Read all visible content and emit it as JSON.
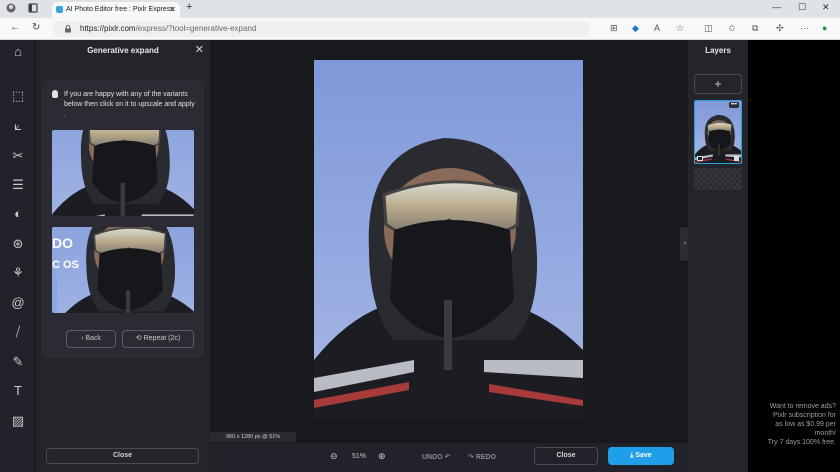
{
  "browser": {
    "tab_title": "AI Photo Editor free : Pixlr Express",
    "url_domain": "https://pixlr.com",
    "url_path": "/express/?tool=generative-expand"
  },
  "panel": {
    "title": "Generative expand",
    "tip": "If you are happy with any of the variants below then click on it to upscale and apply .",
    "back_label": "Back",
    "repeat_label": "Repeat (2c)",
    "close_label": "Close",
    "variant2_text_top": "DO",
    "variant2_text_bottom": "C OS"
  },
  "canvas": {
    "info": "960 x 1280 px @ 51%"
  },
  "bottombar": {
    "zoom": "51%",
    "undo_label": "UNDO",
    "redo_label": "REDO",
    "close_label": "Close",
    "save_label": "Save"
  },
  "layers": {
    "title": "Layers",
    "add_label": "+",
    "more_label": "•••"
  },
  "ad": {
    "line1": "Want to remove ads?",
    "line2": "Pixlr subscription for",
    "line3": "as low as $0.99 per",
    "line4": "month!",
    "line5": "Try 7 days 100% free."
  },
  "colors": {
    "accent": "#1f9fe8",
    "sky": "#8fa7df"
  }
}
